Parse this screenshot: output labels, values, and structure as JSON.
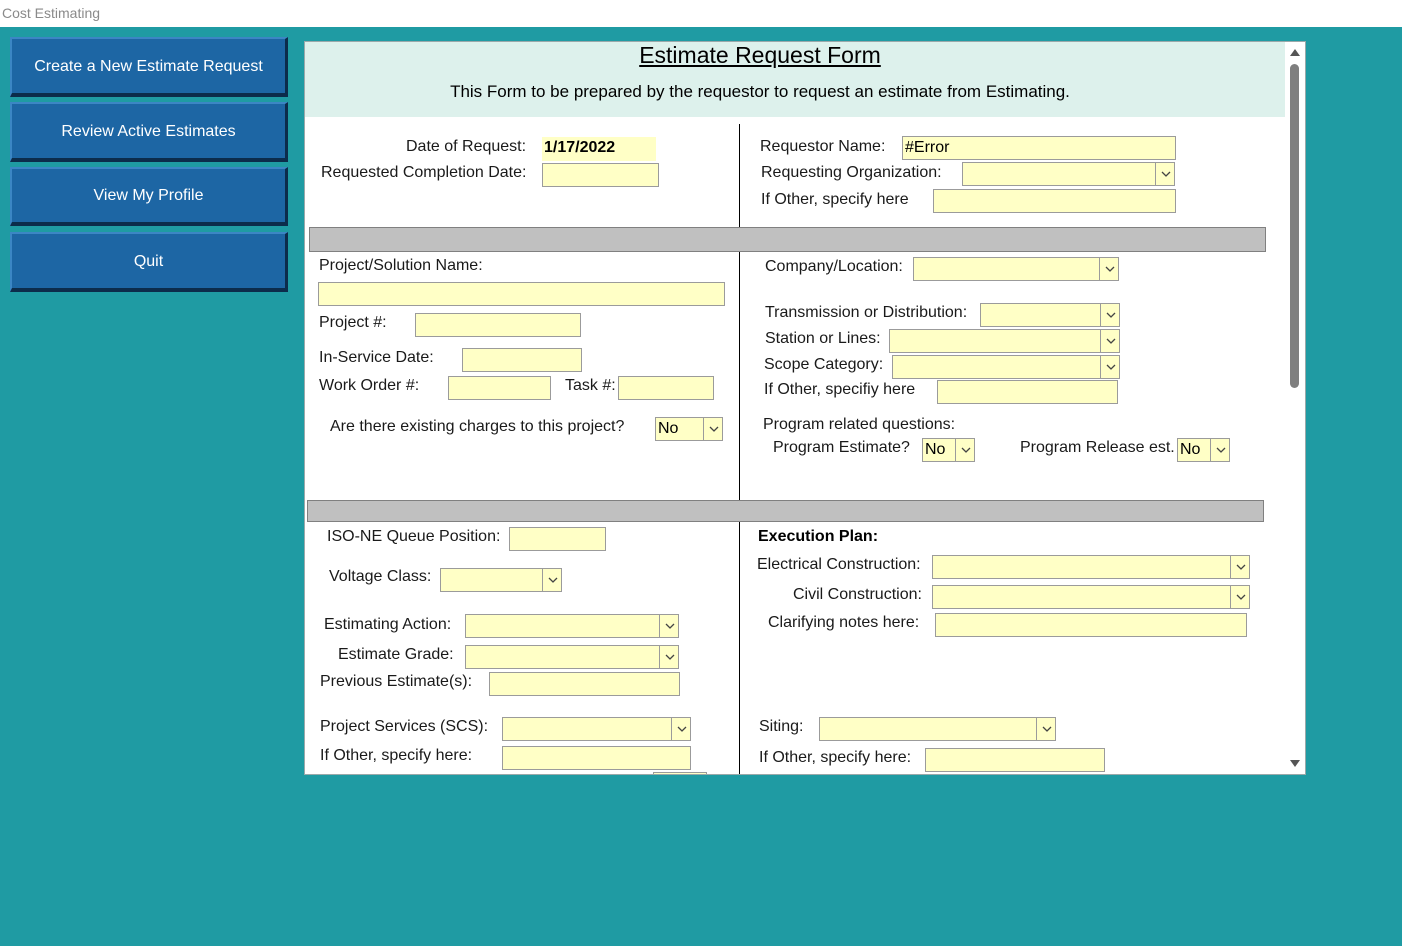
{
  "app": {
    "title": "Cost Estimating"
  },
  "nav": {
    "create_new": "Create a New Estimate Request",
    "review_active": "Review Active Estimates",
    "view_profile": "View My Profile",
    "quit": "Quit"
  },
  "form": {
    "title": "Estimate Request Form",
    "subtitle": "This Form to be prepared by the requestor to request an estimate from Estimating.",
    "date_of_request": {
      "label": "Date of Request:",
      "value": "1/17/2022"
    },
    "requested_completion": {
      "label": "Requested Completion Date:",
      "value": ""
    },
    "requestor_name": {
      "label": "Requestor Name:",
      "value": "#Error"
    },
    "requesting_org": {
      "label": "Requesting Organization:",
      "value": ""
    },
    "requesting_org_other": {
      "label": "If Other, specify here",
      "value": ""
    },
    "project_name": {
      "label": "Project/Solution Name:",
      "value": ""
    },
    "project_number": {
      "label": "Project #:",
      "value": ""
    },
    "in_service_date": {
      "label": "In-Service Date:",
      "value": ""
    },
    "work_order": {
      "label": "Work Order #:",
      "value": ""
    },
    "task": {
      "label": "Task #:",
      "value": ""
    },
    "existing_charges": {
      "label": "Are there existing charges to this project?",
      "value": "No"
    },
    "company_location": {
      "label": "Company/Location:",
      "value": ""
    },
    "transmission_distribution": {
      "label": "Transmission or Distribution:",
      "value": ""
    },
    "station_lines": {
      "label": "Station or Lines:",
      "value": ""
    },
    "scope_category": {
      "label": "Scope Category:",
      "value": ""
    },
    "scope_other": {
      "label": "If Other, specifiy here",
      "value": ""
    },
    "program_questions": {
      "label": "Program related questions:"
    },
    "program_estimate": {
      "label": "Program Estimate?",
      "value": "No"
    },
    "program_release": {
      "label": "Program Release est.",
      "value": "No"
    },
    "iso_queue": {
      "label": "ISO-NE Queue Position:",
      "value": ""
    },
    "voltage_class": {
      "label": "Voltage Class:",
      "value": ""
    },
    "estimating_action": {
      "label": "Estimating Action:",
      "value": ""
    },
    "estimate_grade": {
      "label": "Estimate Grade:",
      "value": ""
    },
    "previous_estimates": {
      "label": "Previous Estimate(s):",
      "value": ""
    },
    "project_services": {
      "label": "Project Services (SCS):",
      "value": ""
    },
    "project_services_other": {
      "label": "If Other, specify here:",
      "value": ""
    },
    "execution_plan": {
      "label": "Execution Plan:"
    },
    "electrical_construction": {
      "label": "Electrical Construction:",
      "value": ""
    },
    "civil_construction": {
      "label": "Civil Construction:",
      "value": ""
    },
    "clarifying_notes": {
      "label": "Clarifying notes here:",
      "value": ""
    },
    "siting": {
      "label": "Siting:",
      "value": ""
    },
    "siting_other": {
      "label": "If Other, specify here:",
      "value": ""
    }
  },
  "icons": {
    "dropdown": "chevron-down-icon",
    "scroll_up": "triangle-up-icon",
    "scroll_down": "triangle-down-icon"
  },
  "colors": {
    "background": "#1f9ba3",
    "nav_button": "#1d66a4",
    "field": "#ffffc6",
    "header": "#ddf1ec",
    "separator": "#c0c0c0"
  }
}
